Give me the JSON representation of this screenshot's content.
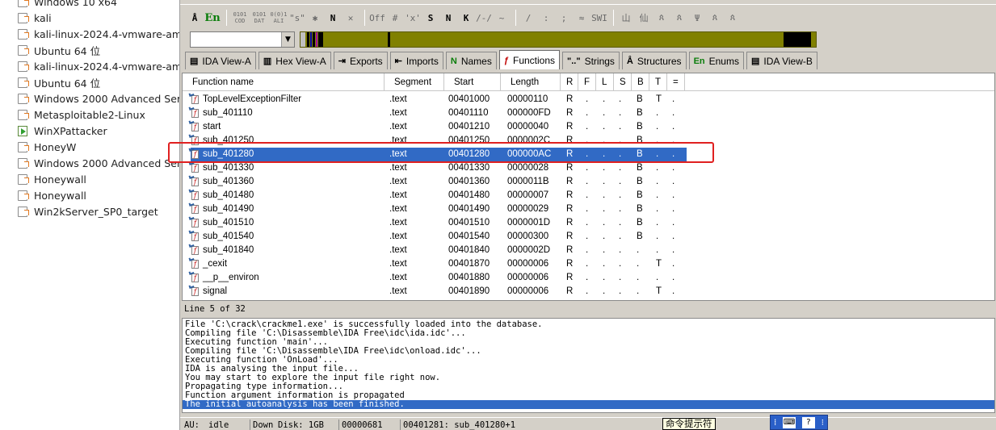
{
  "sidebar": {
    "items": [
      {
        "label": "Windows 10 x64",
        "state": "off"
      },
      {
        "label": "kali",
        "state": "off"
      },
      {
        "label": "kali-linux-2024.4-vmware-amd64",
        "state": "off"
      },
      {
        "label": "Ubuntu 64 位",
        "state": "off"
      },
      {
        "label": "kali-linux-2024.4-vmware-amd64",
        "state": "off"
      },
      {
        "label": "Ubuntu 64 位",
        "state": "off"
      },
      {
        "label": "Windows 2000 Advanced Server",
        "state": "off"
      },
      {
        "label": "Metasploitable2-Linux",
        "state": "off"
      },
      {
        "label": "WinXPattacker",
        "state": "on"
      },
      {
        "label": "HoneyW",
        "state": "off"
      },
      {
        "label": "Windows 2000 Advanced Server",
        "state": "off"
      },
      {
        "label": "Honeywall",
        "state": "off"
      },
      {
        "label": "Honeywall",
        "state": "off"
      },
      {
        "label": "Win2kServer_SP0_target",
        "state": "off"
      }
    ]
  },
  "toolbar": {
    "buttons": [
      "Å",
      "En",
      "0101 COD",
      "0101 DAT",
      "0(0)1 ALI",
      "\"s\"",
      "✱",
      "N",
      "✕",
      "Off",
      "#",
      "'x'",
      "S",
      "N",
      "K",
      "/-/",
      "~",
      "/",
      ":",
      ";",
      "≈",
      "SWI",
      "山",
      "仙",
      "ጰ",
      "ጰ",
      "Ψ",
      "ጰ",
      "ጰ"
    ]
  },
  "tabs": [
    {
      "icon": "▤",
      "label": "IDA View-A"
    },
    {
      "icon": "▥",
      "label": "Hex View-A"
    },
    {
      "icon": "⇥",
      "label": "Exports"
    },
    {
      "icon": "⇤",
      "label": "Imports"
    },
    {
      "icon": "N",
      "label": "Names"
    },
    {
      "icon": "ƒ",
      "label": "Functions",
      "active": true
    },
    {
      "icon": "\"..\"",
      "label": "Strings"
    },
    {
      "icon": "Å",
      "label": "Structures"
    },
    {
      "icon": "En",
      "label": "Enums"
    },
    {
      "icon": "▤",
      "label": "IDA View-B"
    }
  ],
  "functions": {
    "headers": [
      "Function name",
      "Segment",
      "Start",
      "Length",
      "R",
      "F",
      "L",
      "S",
      "B",
      "T",
      "="
    ],
    "rows": [
      {
        "name": "TopLevelExceptionFilter",
        "segment": ".text",
        "start": "00401000",
        "length": "00000110",
        "R": "R",
        "F": ".",
        "L": ".",
        "S": ".",
        "B": "B",
        "T": "T",
        "E": "."
      },
      {
        "name": "sub_401110",
        "segment": ".text",
        "start": "00401110",
        "length": "000000FD",
        "R": "R",
        "F": ".",
        "L": ".",
        "S": ".",
        "B": "B",
        "T": ".",
        "E": "."
      },
      {
        "name": "start",
        "segment": ".text",
        "start": "00401210",
        "length": "00000040",
        "R": "R",
        "F": ".",
        "L": ".",
        "S": ".",
        "B": "B",
        "T": ".",
        "E": "."
      },
      {
        "name": "sub_401250",
        "segment": ".text",
        "start": "00401250",
        "length": "0000002C",
        "R": "R",
        "F": ".",
        "L": ".",
        "S": ".",
        "B": "B",
        "T": ".",
        "E": "."
      },
      {
        "name": "sub_401280",
        "segment": ".text",
        "start": "00401280",
        "length": "000000AC",
        "R": "R",
        "F": ".",
        "L": ".",
        "S": ".",
        "B": "B",
        "T": ".",
        "E": ".",
        "selected": true
      },
      {
        "name": "sub_401330",
        "segment": ".text",
        "start": "00401330",
        "length": "00000028",
        "R": "R",
        "F": ".",
        "L": ".",
        "S": ".",
        "B": "B",
        "T": ".",
        "E": "."
      },
      {
        "name": "sub_401360",
        "segment": ".text",
        "start": "00401360",
        "length": "0000011B",
        "R": "R",
        "F": ".",
        "L": ".",
        "S": ".",
        "B": "B",
        "T": ".",
        "E": "."
      },
      {
        "name": "sub_401480",
        "segment": ".text",
        "start": "00401480",
        "length": "00000007",
        "R": "R",
        "F": ".",
        "L": ".",
        "S": ".",
        "B": "B",
        "T": ".",
        "E": "."
      },
      {
        "name": "sub_401490",
        "segment": ".text",
        "start": "00401490",
        "length": "00000029",
        "R": "R",
        "F": ".",
        "L": ".",
        "S": ".",
        "B": "B",
        "T": ".",
        "E": "."
      },
      {
        "name": "sub_401510",
        "segment": ".text",
        "start": "00401510",
        "length": "0000001D",
        "R": "R",
        "F": ".",
        "L": ".",
        "S": ".",
        "B": "B",
        "T": ".",
        "E": "."
      },
      {
        "name": "sub_401540",
        "segment": ".text",
        "start": "00401540",
        "length": "00000300",
        "R": "R",
        "F": ".",
        "L": ".",
        "S": ".",
        "B": "B",
        "T": ".",
        "E": "."
      },
      {
        "name": "sub_401840",
        "segment": ".text",
        "start": "00401840",
        "length": "0000002D",
        "R": "R",
        "F": ".",
        "L": ".",
        "S": ".",
        "B": ".",
        "T": ".",
        "E": "."
      },
      {
        "name": "_cexit",
        "segment": ".text",
        "start": "00401870",
        "length": "00000006",
        "R": "R",
        "F": ".",
        "L": ".",
        "S": ".",
        "B": ".",
        "T": "T",
        "E": "."
      },
      {
        "name": "__p__environ",
        "segment": ".text",
        "start": "00401880",
        "length": "00000006",
        "R": "R",
        "F": ".",
        "L": ".",
        "S": ".",
        "B": ".",
        "T": ".",
        "E": "."
      },
      {
        "name": "signal",
        "segment": ".text",
        "start": "00401890",
        "length": "00000006",
        "R": "R",
        "F": ".",
        "L": ".",
        "S": ".",
        "B": ".",
        "T": "T",
        "E": "."
      }
    ]
  },
  "line_status": "Line 5 of 32",
  "output": {
    "lines": [
      "File 'C:\\crack\\crackme1.exe' is successfully loaded into the database.",
      "Compiling file 'C:\\Disassemble\\IDA Free\\idc\\ida.idc'...",
      "Executing function 'main'...",
      "Compiling file 'C:\\Disassemble\\IDA Free\\idc\\onload.idc'...",
      "Executing function 'OnLoad'...",
      "IDA is analysing the input file...",
      "You may start to explore the input file right now.",
      "Propagating type information...",
      "Function argument information is propagated",
      "The initial autoanalysis has been finished."
    ],
    "selected_index": 9
  },
  "statusbar": {
    "au": "AU:",
    "state": "idle",
    "direction": "Down",
    "disk": "Disk: 1GB",
    "offset": "00000681",
    "location": "00401281: sub_401280+1"
  },
  "tooltip": "命令提示符",
  "colors": {
    "selection": "#316ac5",
    "nav_band": "#808000",
    "highlight_box": "#e02020"
  }
}
